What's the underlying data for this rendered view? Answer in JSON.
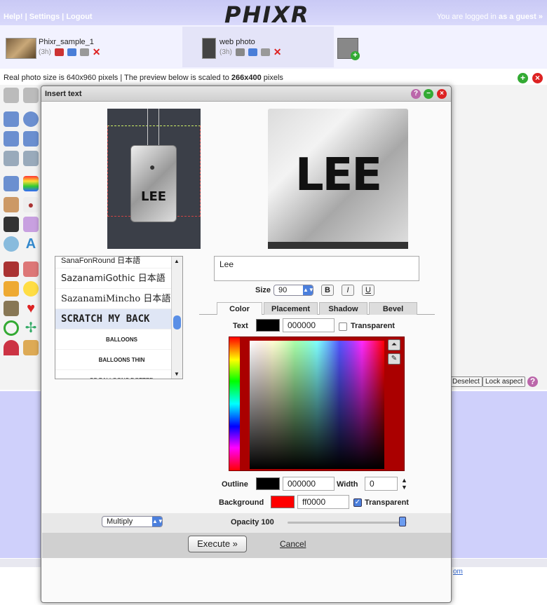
{
  "topbar": {
    "help": "Help!",
    "settings": "Settings",
    "logout": "Logout",
    "sep": "|",
    "logo": "PHIXR",
    "login_prefix": "You are logged in",
    "login_user": "as a guest",
    "login_arrow": "»"
  },
  "tabs": [
    {
      "name": "Phixr_sample_1",
      "age": "(3h)"
    },
    {
      "name": "web photo",
      "age": "(3h)"
    }
  ],
  "info": {
    "prefix": "Real photo size is 640x960 pixels | The preview below is scaled to ",
    "scaled": "266x400",
    "suffix": " pixels"
  },
  "right_buttons": {
    "deselect": "Deselect",
    "lock_aspect": "Lock aspect",
    "help": "?"
  },
  "footer_link": "om",
  "dialog": {
    "title": "Insert text",
    "preview_text": "LEE",
    "fonts": [
      "SanaFonRound 日本語",
      "SazanamiGothic 日本語",
      "SazanamiMincho 日本語",
      "SCRATCH MY BACK",
      "BALLOONS",
      "BALLOONS THIN",
      "SS BALLOONS DOTTED"
    ],
    "text_value": "Lee",
    "size_label": "Size",
    "size_value": "90",
    "bold": "B",
    "italic": "I",
    "underline": "U",
    "prop_tabs": [
      "Color",
      "Placement",
      "Shadow",
      "Bevel"
    ],
    "text_label": "Text",
    "text_color": "000000",
    "transparent_label": "Transparent",
    "outline_label": "Outline",
    "outline_color": "000000",
    "width_label": "Width",
    "width_value": "0",
    "background_label": "Background",
    "background_color": "ff0000",
    "background_transparent_label": "Transparent",
    "blend_mode": "Multiply",
    "opacity_label": "Opacity 100",
    "opacity_value": 100,
    "execute": "Execute »",
    "cancel": "Cancel"
  },
  "colors": {
    "accent": "#4b7fdc",
    "topbar": "#cfd0fb",
    "red": "#dd2222",
    "green": "#33aa33"
  }
}
